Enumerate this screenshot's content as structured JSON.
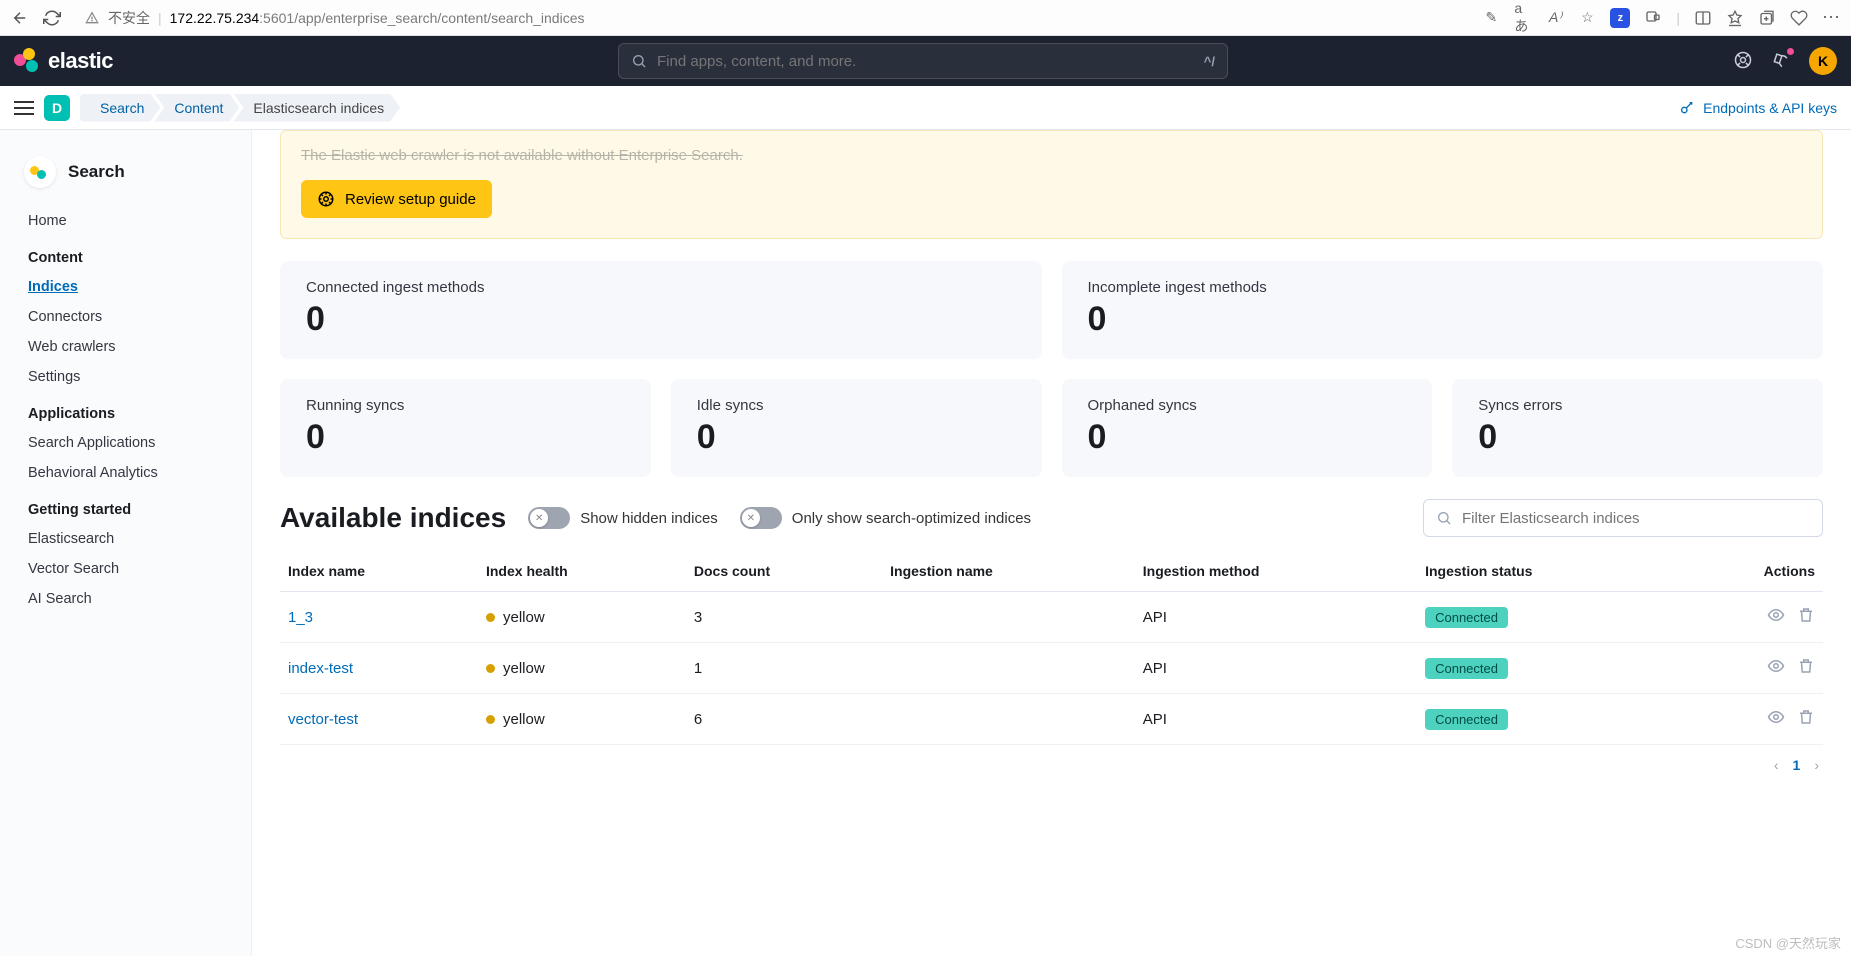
{
  "browser": {
    "insecure_label": "不安全",
    "url_host": "172.22.75.234",
    "url_port_path": ":5601/app/enterprise_search/content/search_indices",
    "lang_hint": "aあ"
  },
  "topnav": {
    "brand": "elastic",
    "search_placeholder": "Find apps, content, and more.",
    "keyboard_hint": "^/",
    "avatar_initial": "K"
  },
  "crumbbar": {
    "space_initial": "D",
    "crumbs": [
      "Search",
      "Content",
      "Elasticsearch indices"
    ],
    "right_link": "Endpoints & API keys"
  },
  "sidebar": {
    "title": "Search",
    "home": "Home",
    "sections": [
      {
        "heading": "Content",
        "items": [
          "Indices",
          "Connectors",
          "Web crawlers",
          "Settings"
        ],
        "active": "Indices"
      },
      {
        "heading": "Applications",
        "items": [
          "Search Applications",
          "Behavioral Analytics"
        ]
      },
      {
        "heading": "Getting started",
        "items": [
          "Elasticsearch",
          "Vector Search",
          "AI Search"
        ]
      }
    ]
  },
  "callout": {
    "message": "The Elastic web crawler is not available without Enterprise Search.",
    "button": "Review setup guide"
  },
  "stats_top": [
    {
      "label": "Connected ingest methods",
      "value": "0"
    },
    {
      "label": "Incomplete ingest methods",
      "value": "0"
    }
  ],
  "stats_bottom": [
    {
      "label": "Running syncs",
      "value": "0"
    },
    {
      "label": "Idle syncs",
      "value": "0"
    },
    {
      "label": "Orphaned syncs",
      "value": "0"
    },
    {
      "label": "Syncs errors",
      "value": "0"
    }
  ],
  "indices_section": {
    "title": "Available indices",
    "toggle1": "Show hidden indices",
    "toggle2": "Only show search-optimized indices",
    "filter_placeholder": "Filter Elasticsearch indices"
  },
  "table": {
    "headers": [
      "Index name",
      "Index health",
      "Docs count",
      "Ingestion name",
      "Ingestion method",
      "Ingestion status",
      "Actions"
    ],
    "rows": [
      {
        "name": "1_3",
        "health": "yellow",
        "docs": "3",
        "ing_name": "",
        "ing_method": "API",
        "status": "Connected"
      },
      {
        "name": "index-test",
        "health": "yellow",
        "docs": "1",
        "ing_name": "",
        "ing_method": "API",
        "status": "Connected"
      },
      {
        "name": "vector-test",
        "health": "yellow",
        "docs": "6",
        "ing_name": "",
        "ing_method": "API",
        "status": "Connected"
      }
    ]
  },
  "pager": {
    "current": "1"
  },
  "watermark": "CSDN @天然玩家"
}
